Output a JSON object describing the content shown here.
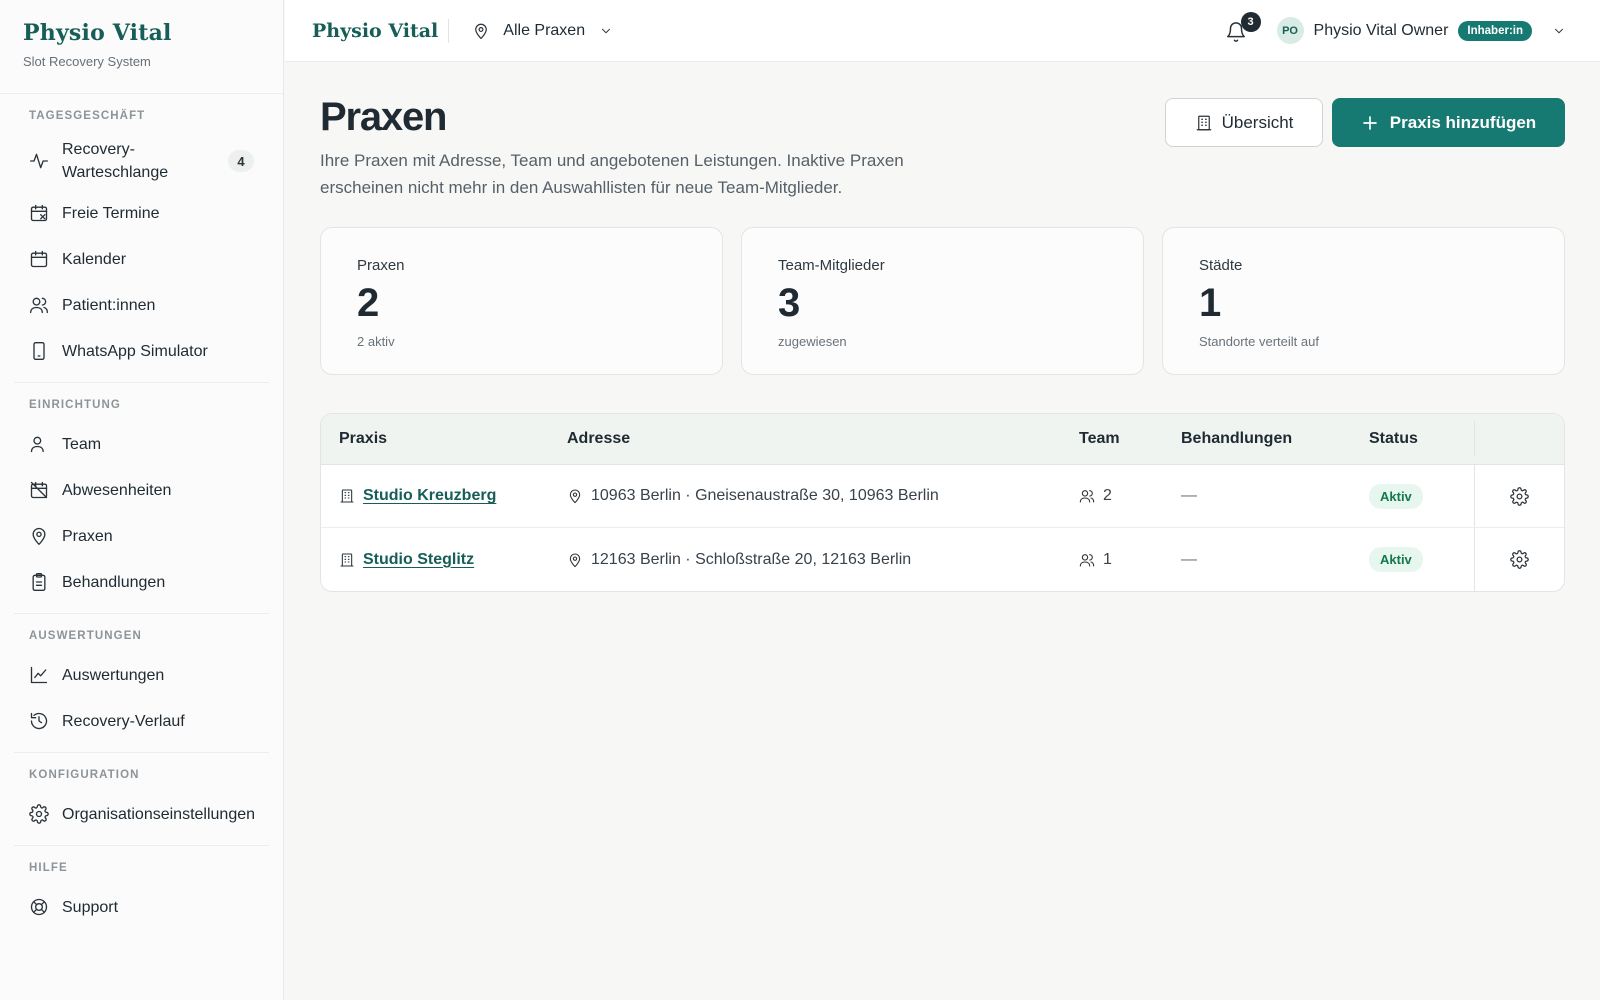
{
  "brand": {
    "title": "Physio Vital",
    "subtitle": "Slot Recovery System"
  },
  "sidebar": {
    "sections": [
      {
        "label": "TAGESGESCHÄFT",
        "items": [
          {
            "label": "Recovery-Warteschlange",
            "icon": "activity-icon",
            "badge": "4"
          },
          {
            "label": "Freie Termine",
            "icon": "calendar-x-icon"
          },
          {
            "label": "Kalender",
            "icon": "calendar-icon"
          },
          {
            "label": "Patient:innen",
            "icon": "users-icon"
          },
          {
            "label": "WhatsApp Simulator",
            "icon": "smartphone-icon"
          }
        ]
      },
      {
        "label": "EINRICHTUNG",
        "items": [
          {
            "label": "Team",
            "icon": "user-icon"
          },
          {
            "label": "Abwesenheiten",
            "icon": "calendar-off-icon"
          },
          {
            "label": "Praxen",
            "icon": "map-pin-icon"
          },
          {
            "label": "Behandlungen",
            "icon": "clipboard-icon"
          }
        ]
      },
      {
        "label": "AUSWERTUNGEN",
        "items": [
          {
            "label": "Auswertungen",
            "icon": "line-chart-icon"
          },
          {
            "label": "Recovery-Verlauf",
            "icon": "history-icon"
          }
        ]
      },
      {
        "label": "KONFIGURATION",
        "items": [
          {
            "label": "Organisationseinstellungen",
            "icon": "gear-icon"
          }
        ]
      },
      {
        "label": "HILFE",
        "items": [
          {
            "label": "Support",
            "icon": "lifebuoy-icon"
          }
        ]
      }
    ]
  },
  "header": {
    "brand": "Physio Vital",
    "location_select": "Alle Praxen",
    "notifications": "3",
    "user_initials": "PO",
    "user_name": "Physio Vital Owner",
    "role": "Inhaber:in"
  },
  "page": {
    "title": "Praxen",
    "description": "Ihre Praxen mit Adresse, Team und angebotenen Leistungen. Inaktive Praxen erscheinen nicht mehr in den Auswahllisten für neue Team-Mitglieder.",
    "overview_button": "Übersicht",
    "add_button": "Praxis hinzufügen"
  },
  "stats": [
    {
      "label": "Praxen",
      "value": "2",
      "sub": "2 aktiv"
    },
    {
      "label": "Team-Mitglieder",
      "value": "3",
      "sub": "zugewiesen"
    },
    {
      "label": "Städte",
      "value": "1",
      "sub": "Standorte verteilt auf"
    }
  ],
  "table": {
    "columns": [
      "Praxis",
      "Adresse",
      "Team",
      "Behandlungen",
      "Status"
    ],
    "rows": [
      {
        "name": "Studio Kreuzberg",
        "address": "10963 Berlin · Gneisenaustraße 30, 10963 Berlin",
        "team": "2",
        "treatments": "—",
        "status": "Aktiv"
      },
      {
        "name": "Studio Steglitz",
        "address": "12163 Berlin · Schloßstraße 20, 12163 Berlin",
        "team": "1",
        "treatments": "—",
        "status": "Aktiv"
      }
    ]
  },
  "colors": {
    "brand": "#165e57",
    "accent": "#167a72",
    "status_active": "#14794a"
  }
}
